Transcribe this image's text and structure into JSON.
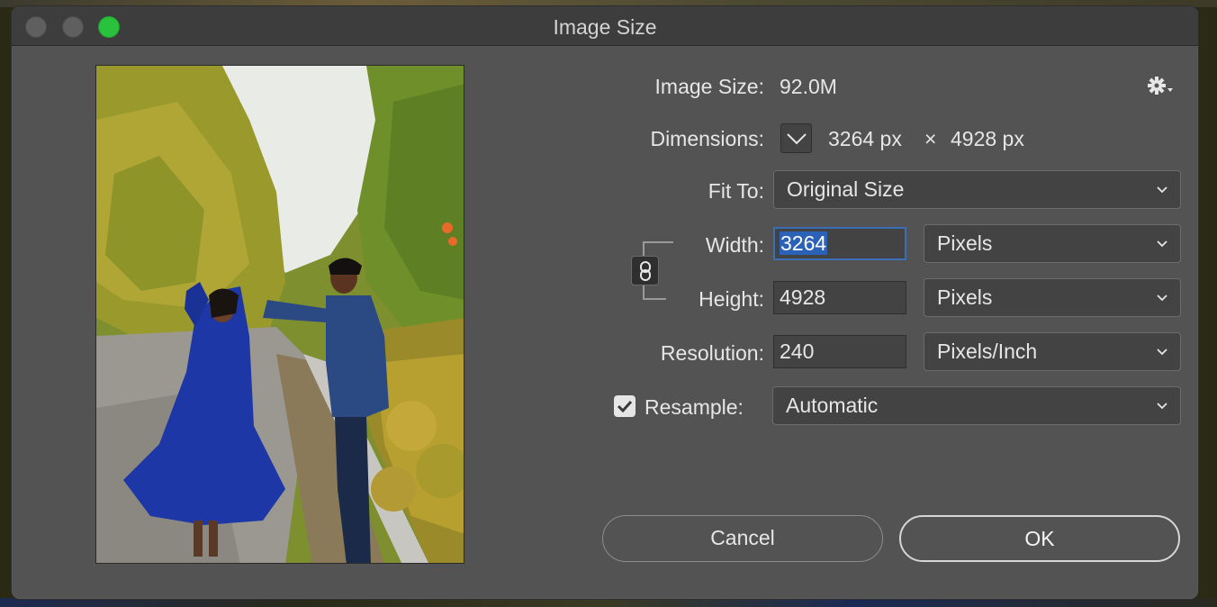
{
  "window": {
    "title": "Image Size"
  },
  "info": {
    "image_size_label": "Image Size:",
    "image_size_value": "92.0M",
    "dimensions_label": "Dimensions:",
    "dimensions_width": "3264 px",
    "dimensions_times": "×",
    "dimensions_height": "4928 px"
  },
  "fit_to": {
    "label": "Fit To:",
    "value": "Original Size"
  },
  "width": {
    "label": "Width:",
    "value": "3264",
    "unit": "Pixels"
  },
  "height": {
    "label": "Height:",
    "value": "4928",
    "unit": "Pixels"
  },
  "resolution": {
    "label": "Resolution:",
    "value": "240",
    "unit": "Pixels/Inch"
  },
  "resample": {
    "label": "Resample:",
    "checked": true,
    "value": "Automatic"
  },
  "buttons": {
    "cancel": "Cancel",
    "ok": "OK"
  },
  "icons": {
    "settings": "gear-icon",
    "dimensions_toggle": "chevron-down-icon",
    "constrain": "link-icon",
    "dropdown": "chevron-down-icon",
    "check": "checkmark-icon"
  },
  "colors": {
    "dialog_bg": "#535353",
    "titlebar_bg": "#3d3d3d",
    "field_bg": "#434343",
    "focus_ring": "#3b6fb5",
    "selection": "#2b62b8",
    "zoom_button": "#2ac13d"
  }
}
